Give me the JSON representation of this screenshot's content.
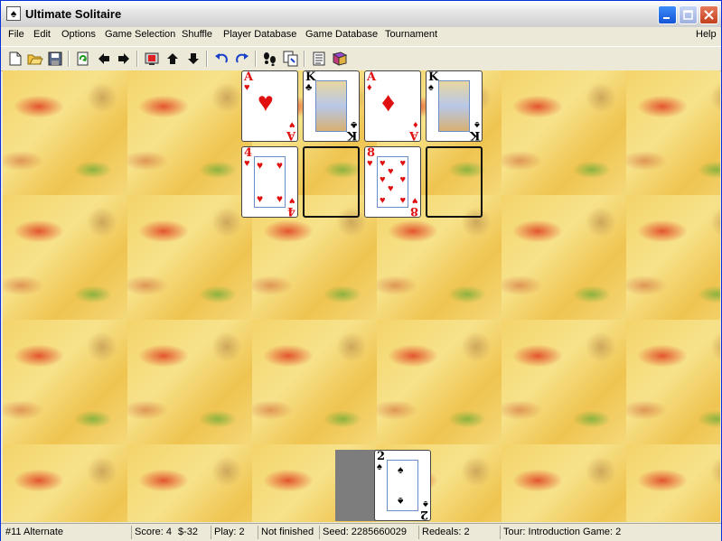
{
  "window": {
    "title": "Ultimate Solitaire"
  },
  "menu": {
    "items": [
      "File",
      "Edit",
      "Options",
      "Game Selection",
      "Shuffle",
      "Player Database",
      "Game Database",
      "Tournament"
    ],
    "help": "Help"
  },
  "toolbar": {
    "icons": [
      "new-game",
      "open",
      "save",
      "refresh",
      "back",
      "forward",
      "move-up",
      "move-down",
      "undo",
      "redo",
      "hint",
      "options",
      "notes",
      "book"
    ]
  },
  "foundations": [
    {
      "rank": "A",
      "suit": "♥",
      "color": "red"
    },
    {
      "rank": "K",
      "suit": "♣",
      "color": "black"
    },
    {
      "rank": "A",
      "suit": "♦",
      "color": "red"
    },
    {
      "rank": "K",
      "suit": "♠",
      "color": "black"
    }
  ],
  "tableau": [
    {
      "rank": "4",
      "suit": "♥",
      "color": "red"
    },
    {
      "empty": true
    },
    {
      "rank": "8",
      "suit": "♥",
      "color": "red"
    },
    {
      "empty": true
    }
  ],
  "waste": {
    "rank": "2",
    "suit": "♠",
    "color": "black"
  },
  "status": {
    "game": "#11 Alternate",
    "score": "Score: 4",
    "money": "$-32",
    "play": "Play: 2",
    "state": "Not finished",
    "seed": "Seed: 2285660029",
    "redeals": "Redeals: 2",
    "tour": "Tour: Introduction  Game: 2"
  },
  "colors": {
    "accent": "#0831d9",
    "card_red": "#e01010",
    "table": "#f4d46a"
  }
}
